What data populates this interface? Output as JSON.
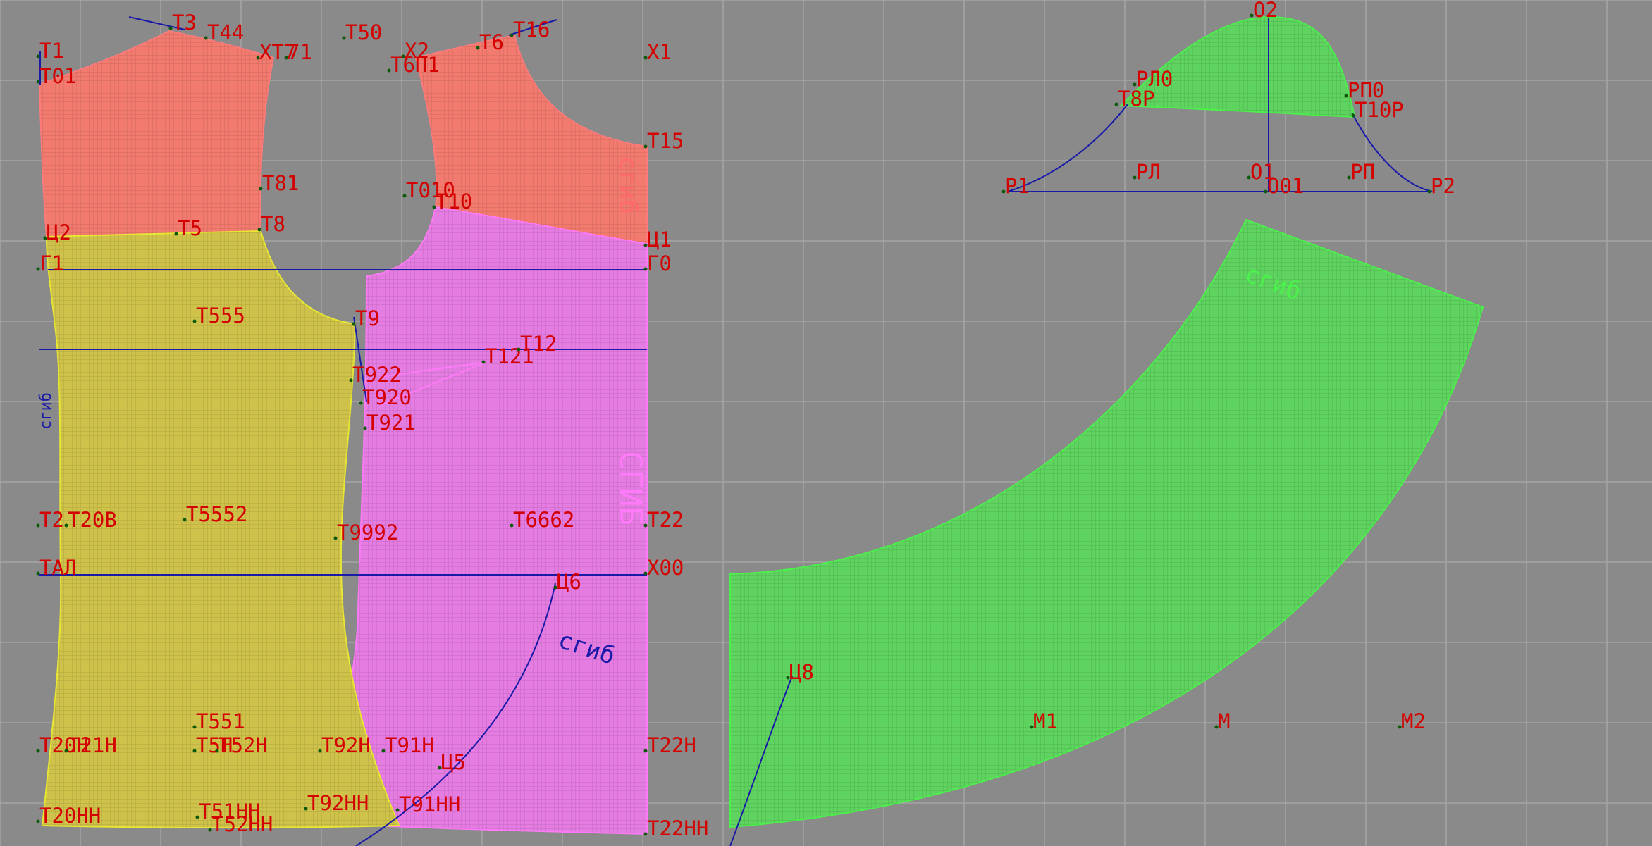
{
  "colors": {
    "background": "#8a8a8a",
    "grid": "#a4a4a4",
    "label": "#d40000",
    "guide": "#1a1aa8",
    "yoke": "#f27a6e",
    "front": "#cfc24a",
    "back": "#e57ce2",
    "collar": "#5fd35f",
    "fold_pink": "#ff7af8",
    "fold_green": "#4cf24c",
    "fold_blue": "#1a1aa8",
    "fold_red": "#ff6a6a"
  },
  "fold_texts": {
    "sleeve": "сгиб",
    "back_yoke": "сгиб",
    "front": "сгиб",
    "back": "СГИБ",
    "collar_guide": "сгиб"
  },
  "labels": {
    "T3": "T3",
    "T44": "T44",
    "XT7": "XT7",
    "T71": "71",
    "T50": "T50",
    "X2": "X2",
    "T6": "T6",
    "T16": "T16",
    "X1": "X1",
    "T1": "T1",
    "T01": "T01",
    "T611": "T6П1",
    "T15": "T15",
    "T81": "T81",
    "T010": "T010",
    "T10": "T10",
    "T8": "T8",
    "U2": "Ц2",
    "T5": "T5",
    "U1": "Ц1",
    "G1": "Г1",
    "G0": "Г0",
    "T555": "T555",
    "T9": "T9",
    "T12": "T12",
    "T121": "T121",
    "T922": "T922",
    "T920": "T920",
    "T921": "T921",
    "T20": "T2",
    "T20B": "T20B",
    "T552": "T5552",
    "T992": "T9992",
    "T662": "T6662",
    "T22": "T22",
    "TAL": "TAЛ",
    "X00": "X00",
    "U6": "Ц6",
    "T551": "T551",
    "T20H": "T20H",
    "T21H": "T21H",
    "T5H": "T5H",
    "T52H": "T52H",
    "T92H": "T92H",
    "T91H": "T91H",
    "U5": "Ц5",
    "T22H": "T22H",
    "T20HH": "T20HH",
    "T51HH": "T51HH",
    "T52HH": "T52HH",
    "T92HH": "T92HH",
    "T91HH": "T91HH",
    "T22HH": "T22HH",
    "O2": "O2",
    "RL0": "PЛ0",
    "RP0": "PП0",
    "T8R": "T8P",
    "T10R": "T10P",
    "R1": "P1",
    "RL": "PЛ",
    "O1": "O1",
    "O01": "O01",
    "RP": "PП",
    "R2": "P2",
    "U8": "Ц8",
    "M1": "M1",
    "M": "M",
    "M2": "M2"
  }
}
